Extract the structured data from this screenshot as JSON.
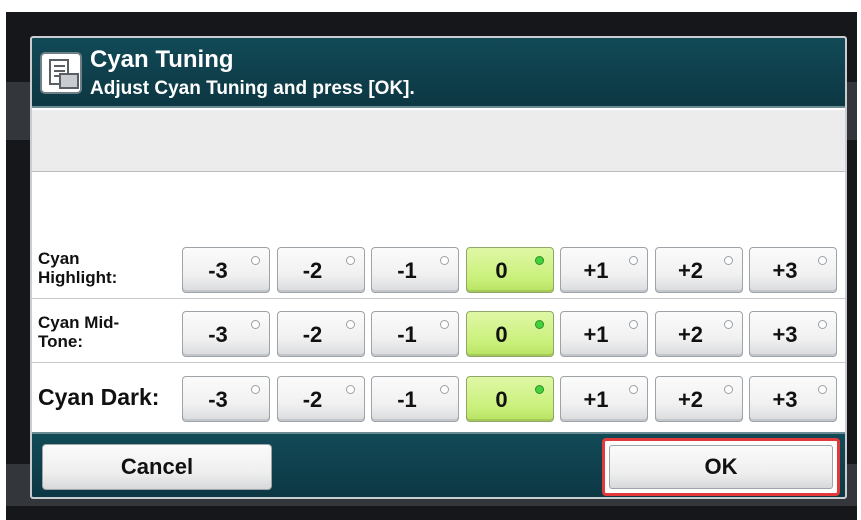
{
  "dialog": {
    "title": "Cyan Tuning",
    "subtitle": "Adjust Cyan Tuning and press [OK].",
    "icon": "document-settings-icon"
  },
  "rows": [
    {
      "label": "Cyan\nHighlight:",
      "selected": "0"
    },
    {
      "label": "Cyan Mid-\nTone:",
      "selected": "0"
    },
    {
      "label": "Cyan Dark:",
      "selected": "0"
    }
  ],
  "options": [
    "-3",
    "-2",
    "-1",
    "0",
    "+1",
    "+2",
    "+3"
  ],
  "footer": {
    "cancel_label": "Cancel",
    "ok_label": "OK"
  },
  "colors": {
    "header": "#0f4250",
    "selected_button": "#c9f07a",
    "indicator_selected": "#43d23b",
    "ok_highlight": "#e23a3a"
  }
}
